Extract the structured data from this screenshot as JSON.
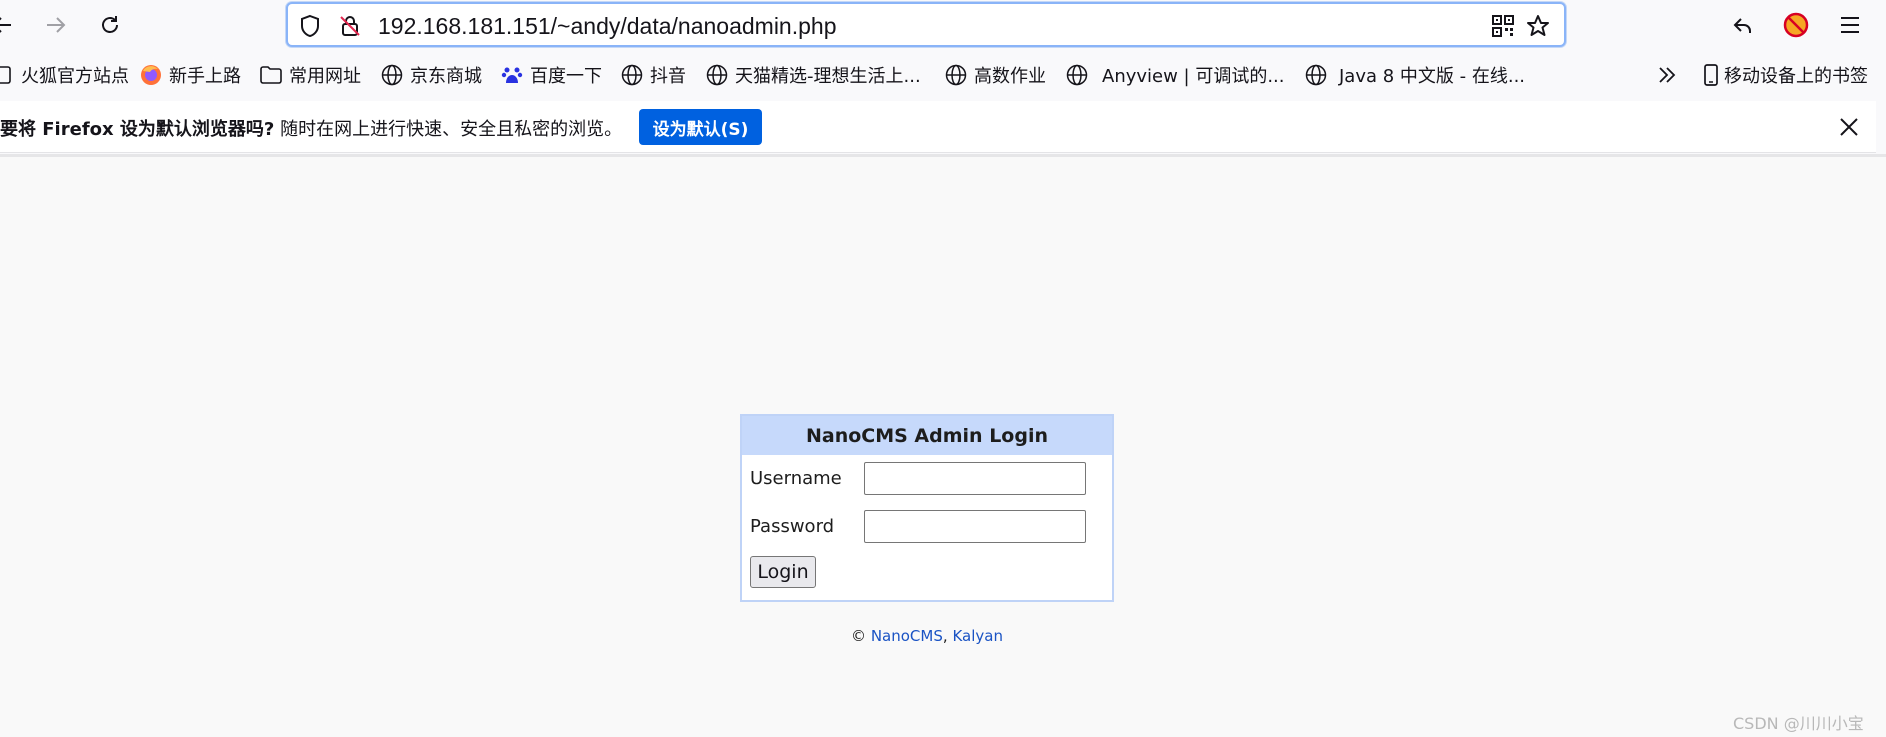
{
  "browser": {
    "url": "192.168.181.151/~andy/data/nanoadmin.php"
  },
  "bookmarks": [
    {
      "label": "火狐官方站点",
      "icon": "bookmark-page-icon"
    },
    {
      "label": "新手上路",
      "icon": "firefox-icon"
    },
    {
      "label": "常用网址",
      "icon": "folder-icon"
    },
    {
      "label": "京东商城",
      "icon": "globe-icon"
    },
    {
      "label": "百度一下",
      "icon": "baidu-icon"
    },
    {
      "label": "抖音",
      "icon": "globe-icon"
    },
    {
      "label": "天猫精选-理想生活上...",
      "icon": "globe-icon"
    },
    {
      "label": "高数作业",
      "icon": "globe-icon"
    },
    {
      "label": "Anyview | 可调试的...",
      "icon": "globe-icon"
    },
    {
      "label": "Java 8 中文版 - 在线...",
      "icon": "globe-icon"
    },
    {
      "label": "移动设备上的书签",
      "icon": "mobile-icon"
    }
  ],
  "notification": {
    "question": "要将 Firefox 设为默认浏览器吗?",
    "message": "随时在网上进行快速、安全且私密的浏览。",
    "button": "设为默认(S)"
  },
  "login": {
    "title": "NanoCMS Admin Login",
    "username_label": "Username",
    "password_label": "Password",
    "username_value": "",
    "password_value": "",
    "button": "Login"
  },
  "footer": {
    "copyright": "©",
    "link1": "NanoCMS",
    "separator": ",",
    "link2": "Kalyan"
  },
  "watermark": "CSDN @川川小宝",
  "colors": {
    "accent": "#0061e0",
    "login_header": "#c6d9fb",
    "link": "#1a53c4"
  }
}
